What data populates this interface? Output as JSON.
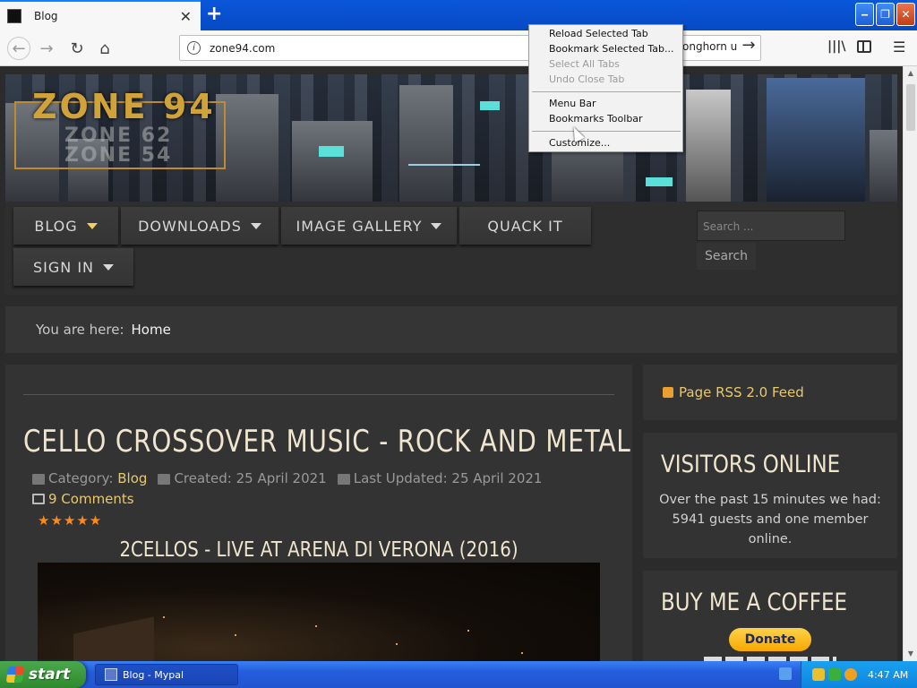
{
  "browser": {
    "tab_title": "Blog",
    "new_tab_symbol": "+",
    "url": "zone94.com",
    "search_text": "onghorn u",
    "close_tab_symbol": "✕"
  },
  "window_buttons": {
    "minimize": "‒",
    "maximize": "❐",
    "close": "✕"
  },
  "site": {
    "logo": "ZONE 94",
    "logo_sub1": "ZONE 62",
    "logo_sub2": "ZONE 54",
    "menu": [
      {
        "label": "BLOG",
        "dropdown": true
      },
      {
        "label": "DOWNLOADS",
        "dropdown": true
      },
      {
        "label": "IMAGE GALLERY",
        "dropdown": true
      },
      {
        "label": "QUACK IT",
        "dropdown": false
      },
      {
        "label": "SIGN IN",
        "dropdown": true
      }
    ],
    "search_placeholder": "Search ...",
    "search_button": "Search",
    "breadcrumb_label": "You are here:",
    "breadcrumb_home": "Home"
  },
  "article": {
    "title": "CELLO CROSSOVER MUSIC - ROCK AND METAL",
    "category_label": "Category:",
    "category": "Blog",
    "created": "Created: 25 April 2021",
    "updated": "Last Updated: 25 April 2021",
    "comments": "9 Comments",
    "stars": "★★★★★",
    "video_title": "2CELLOS - LIVE AT ARENA DI VERONA (2016)"
  },
  "sidebar": {
    "rss": "Page RSS 2.0 Feed",
    "visitors_title": "VISITORS ONLINE",
    "visitors_text": "Over the past 15 minutes we had: 5941 guests and one member online.",
    "coffee_title": "BUY ME A COFFEE",
    "donate": "Donate"
  },
  "context_menu": {
    "items": [
      {
        "label": "Reload Selected Tab",
        "enabled": true
      },
      {
        "label": "Bookmark Selected Tab...",
        "enabled": true
      },
      {
        "label": "Select All Tabs",
        "enabled": false
      },
      {
        "label": "Undo Close Tab",
        "enabled": false
      },
      {
        "label": "Menu Bar",
        "enabled": true
      },
      {
        "label": "Bookmarks Toolbar",
        "enabled": true
      },
      {
        "label": "Customize...",
        "enabled": true
      }
    ]
  },
  "taskbar": {
    "start": "start",
    "task": "Blog - Mypal",
    "clock": "4:47 AM"
  },
  "colors": {
    "accent_gold": "#e9c96a",
    "title_cream": "#f0e6cf",
    "xp_blue": "#245ddb"
  }
}
